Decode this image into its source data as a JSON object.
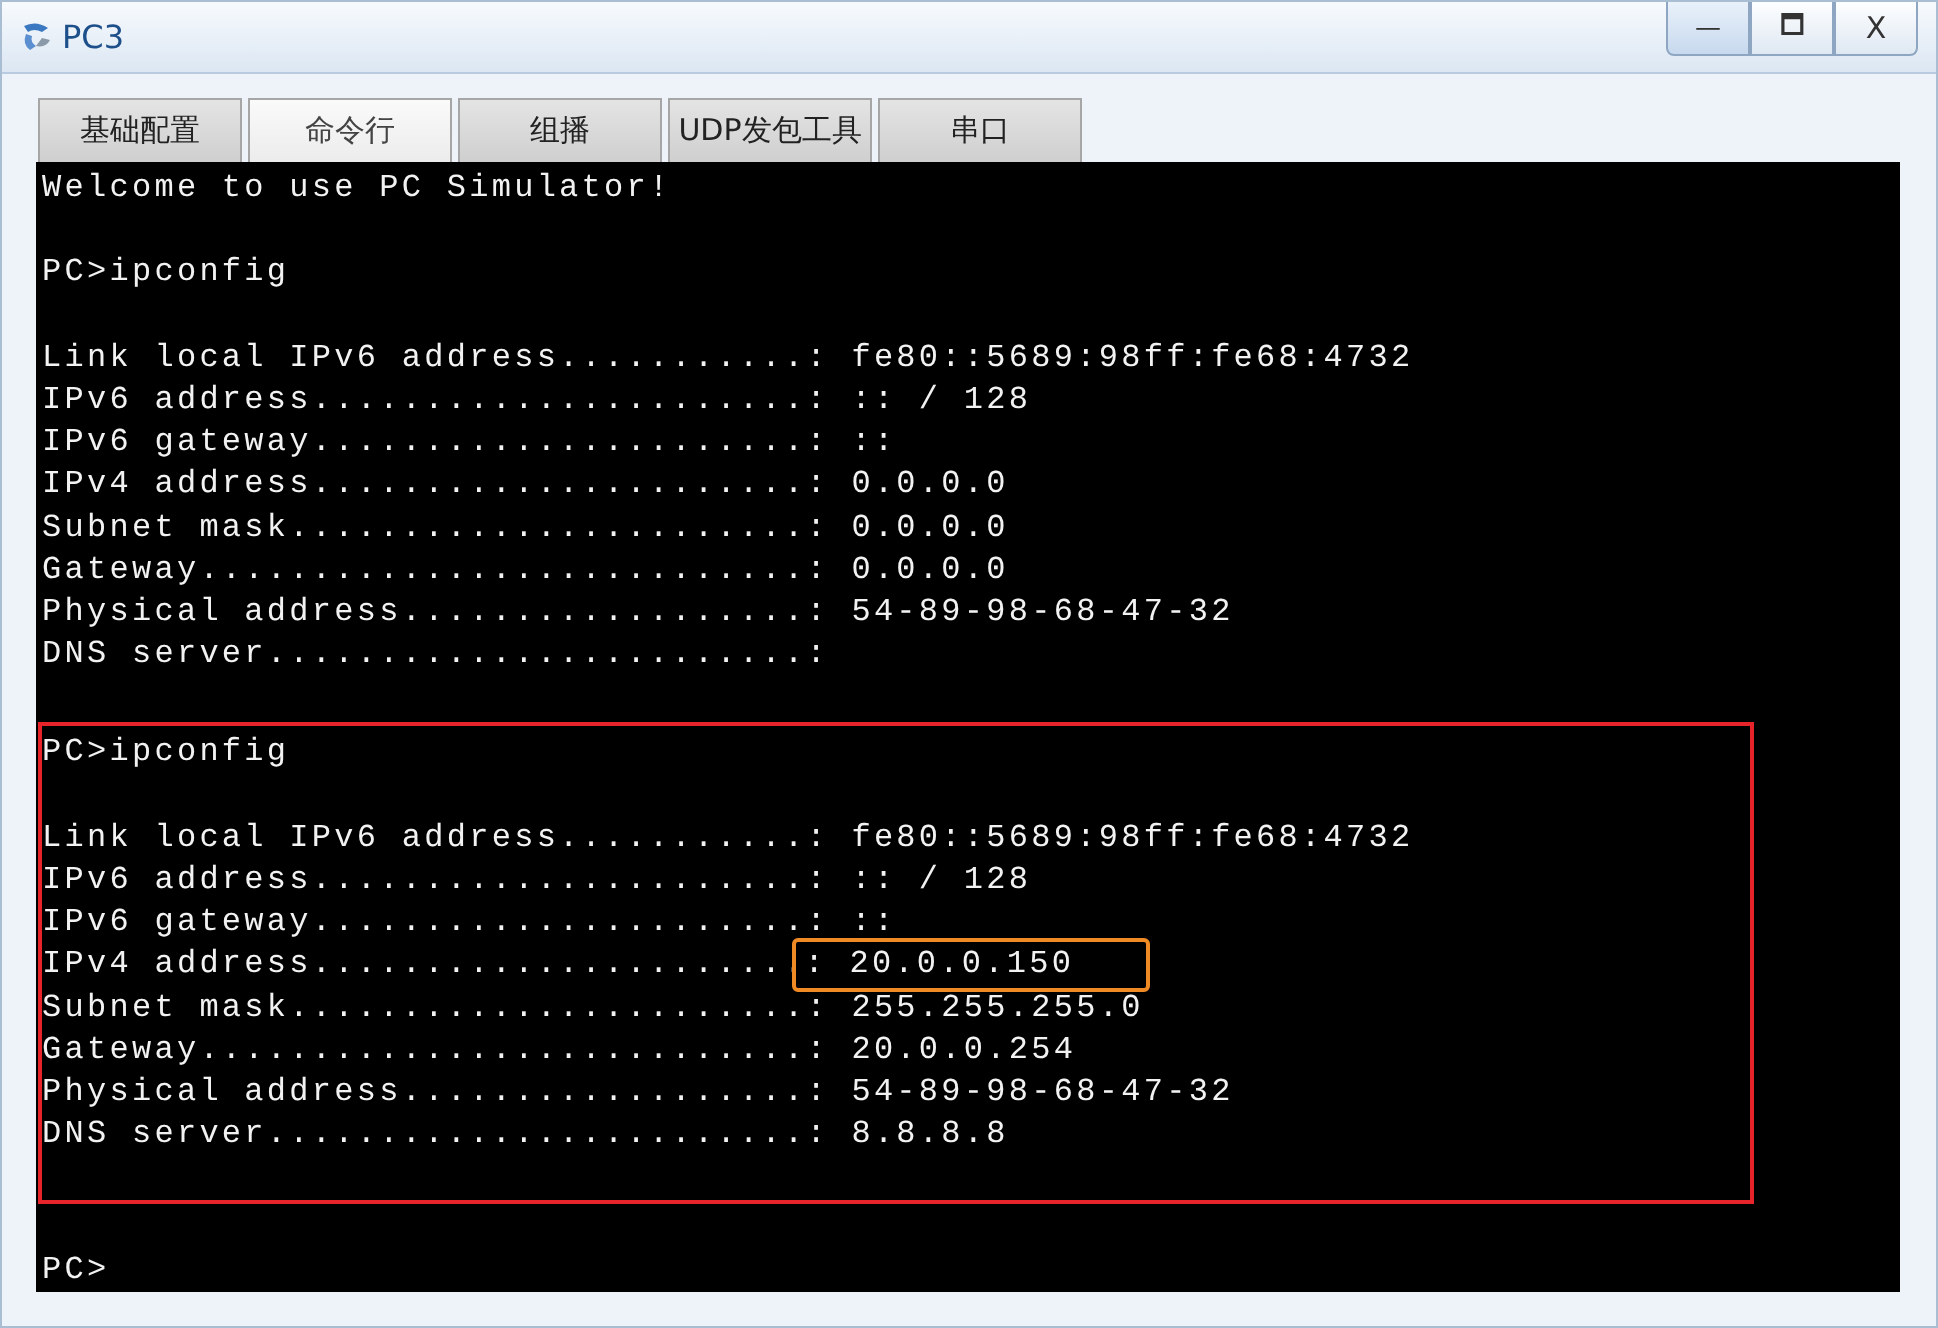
{
  "window": {
    "title": "PC3",
    "controls": [
      {
        "kind": "minimize",
        "label": "—"
      },
      {
        "kind": "maximize",
        "label": "🗖"
      },
      {
        "kind": "close",
        "label": "X"
      }
    ]
  },
  "tabs": [
    {
      "label": "基础配置",
      "selected": false
    },
    {
      "label": "命令行",
      "selected": true
    },
    {
      "label": "组播",
      "selected": false
    },
    {
      "label": "UDP发包工具",
      "selected": false
    },
    {
      "label": "串口",
      "selected": false
    }
  ],
  "terminal": {
    "blocks": [
      {
        "highlighted": false,
        "lines": [
          {
            "kind": "text",
            "text": "Welcome to use PC Simulator!"
          },
          {
            "kind": "blank"
          },
          {
            "kind": "text",
            "text": "PC>ipconfig"
          },
          {
            "kind": "blank"
          },
          {
            "kind": "field",
            "label": "Link local IPv6 address...........",
            "value": ": fe80::5689:98ff:fe68:4732",
            "highlighted": false
          },
          {
            "kind": "field",
            "label": "IPv6 address......................",
            "value": ": :: / 128",
            "highlighted": false
          },
          {
            "kind": "field",
            "label": "IPv6 gateway......................",
            "value": ": ::",
            "highlighted": false
          },
          {
            "kind": "field",
            "label": "IPv4 address......................",
            "value": ": 0.0.0.0",
            "highlighted": false
          },
          {
            "kind": "field",
            "label": "Subnet mask.......................",
            "value": ": 0.0.0.0",
            "highlighted": false
          },
          {
            "kind": "field",
            "label": "Gateway...........................",
            "value": ": 0.0.0.0",
            "highlighted": false
          },
          {
            "kind": "field",
            "label": "Physical address..................",
            "value": ": 54-89-98-68-47-32",
            "highlighted": false
          },
          {
            "kind": "field",
            "label": "DNS server........................",
            "value": ":",
            "highlighted": false
          },
          {
            "kind": "blank"
          }
        ]
      },
      {
        "highlighted": true,
        "lines": [
          {
            "kind": "text",
            "text": "PC>ipconfig"
          },
          {
            "kind": "blank"
          },
          {
            "kind": "field",
            "label": "Link local IPv6 address...........",
            "value": ": fe80::5689:98ff:fe68:4732",
            "highlighted": false
          },
          {
            "kind": "field",
            "label": "IPv6 address......................",
            "value": ": :: / 128",
            "highlighted": false
          },
          {
            "kind": "field",
            "label": "IPv6 gateway......................",
            "value": ": ::",
            "highlighted": false
          },
          {
            "kind": "field",
            "label": "IPv4 address......................",
            "value": ": 20.0.0.150",
            "highlighted": true
          },
          {
            "kind": "field",
            "label": "Subnet mask.......................",
            "value": ": 255.255.255.0",
            "highlighted": false
          },
          {
            "kind": "field",
            "label": "Gateway...........................",
            "value": ": 20.0.0.254",
            "highlighted": false
          },
          {
            "kind": "field",
            "label": "Physical address..................",
            "value": ": 54-89-98-68-47-32",
            "highlighted": false
          },
          {
            "kind": "field",
            "label": "DNS server........................",
            "value": ": 8.8.8.8",
            "highlighted": false
          },
          {
            "kind": "blank"
          }
        ]
      },
      {
        "highlighted": false,
        "lines": [
          {
            "kind": "blank"
          },
          {
            "kind": "text",
            "text": "PC>"
          }
        ]
      }
    ]
  }
}
